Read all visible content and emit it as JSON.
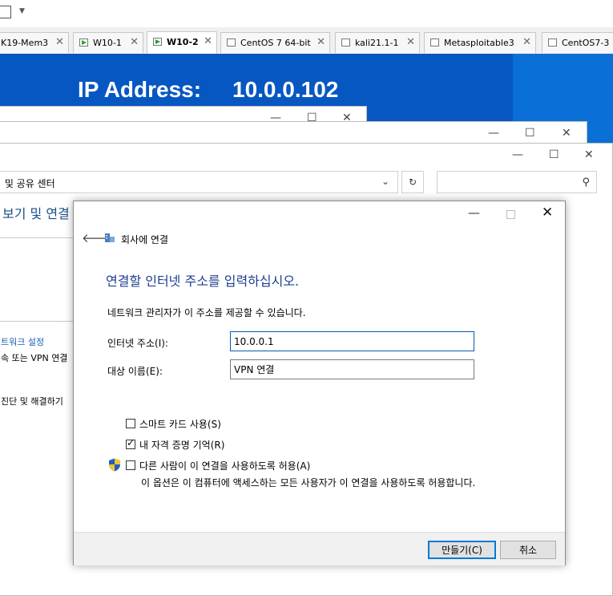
{
  "desktop": {
    "ip_label": "IP Address:",
    "ip_value": "10.0.0.102"
  },
  "tabs": [
    {
      "label": "K19-Mem3",
      "active": false
    },
    {
      "label": "W10-1",
      "active": false
    },
    {
      "label": "W10-2",
      "active": true
    },
    {
      "label": "CentOS 7 64-bit",
      "active": false
    },
    {
      "label": "kali21.1-1",
      "active": false
    },
    {
      "label": "Metasploitable3",
      "active": false
    },
    {
      "label": "CentOS7-3",
      "active": false
    }
  ],
  "window_controls": {
    "minimize": "—",
    "maximize": "☐",
    "close": "✕"
  },
  "explorer": {
    "address_text": " 및 공유 센터",
    "heading": "보기 및 연결",
    "link_network_settings": "트워크 설정",
    "link_vpn": "속 또는 VPN 연결",
    "link_troubleshoot": "진단 및 해결하기"
  },
  "dialog": {
    "title": "회사에 연결",
    "heading": "연결할 인터넷 주소를 입력하십시오.",
    "description": "네트워크 관리자가 이 주소를 제공할 수 있습니다.",
    "internet_address_label": "인터넷 주소(I):",
    "internet_address_value": "10.0.0.1",
    "dest_name_label": "대상 이름(E):",
    "dest_name_value": "VPN 연결",
    "smart_card_label": "스마트 카드 사용(S)",
    "smart_card_checked": false,
    "remember_cred_label": "내 자격 증명 기억(R)",
    "remember_cred_checked": true,
    "allow_others_label": "다른 사람이 이 연결을 사용하도록 허용(A)",
    "allow_others_checked": false,
    "allow_others_note": "이 옵션은 이 컴퓨터에 액세스하는 모든 사용자가 이 연결을 사용하도록 허용합니다.",
    "create_button": "만들기(C)",
    "cancel_button": "취소"
  },
  "colors": {
    "desktop_blue": "#0a6fd6",
    "heading_blue": "#1d3e8f",
    "focus_blue": "#0078d7"
  }
}
